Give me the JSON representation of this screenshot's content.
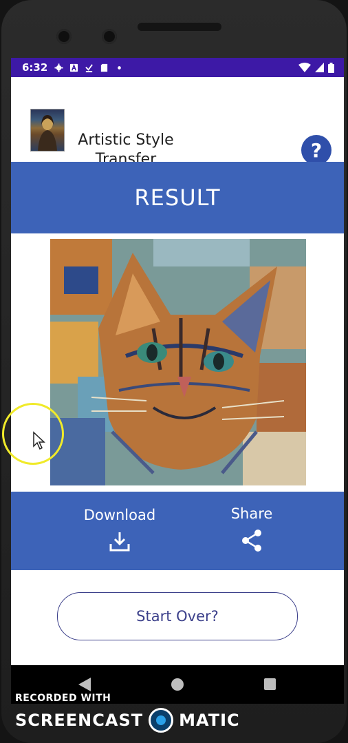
{
  "status_bar": {
    "time": "6:32",
    "icons": [
      "settings-icon",
      "a-icon",
      "download-done-icon",
      "sd-card-icon",
      "dot-icon"
    ],
    "right_icons": [
      "wifi-icon",
      "signal-icon",
      "battery-icon"
    ]
  },
  "header": {
    "title": "Artistic Style Transfer",
    "help_label": "?"
  },
  "banner": {
    "title": "RESULT"
  },
  "actions": {
    "download_label": "Download",
    "share_label": "Share"
  },
  "start_over_label": "Start Over?",
  "watermark": {
    "line1": "RECORDED WITH",
    "left": "SCREENCAST",
    "right": "MATIC"
  },
  "colors": {
    "status": "#3d19a6",
    "primary": "#3d63b8",
    "button_text": "#3b3f8a",
    "help": "#2f4faa"
  }
}
